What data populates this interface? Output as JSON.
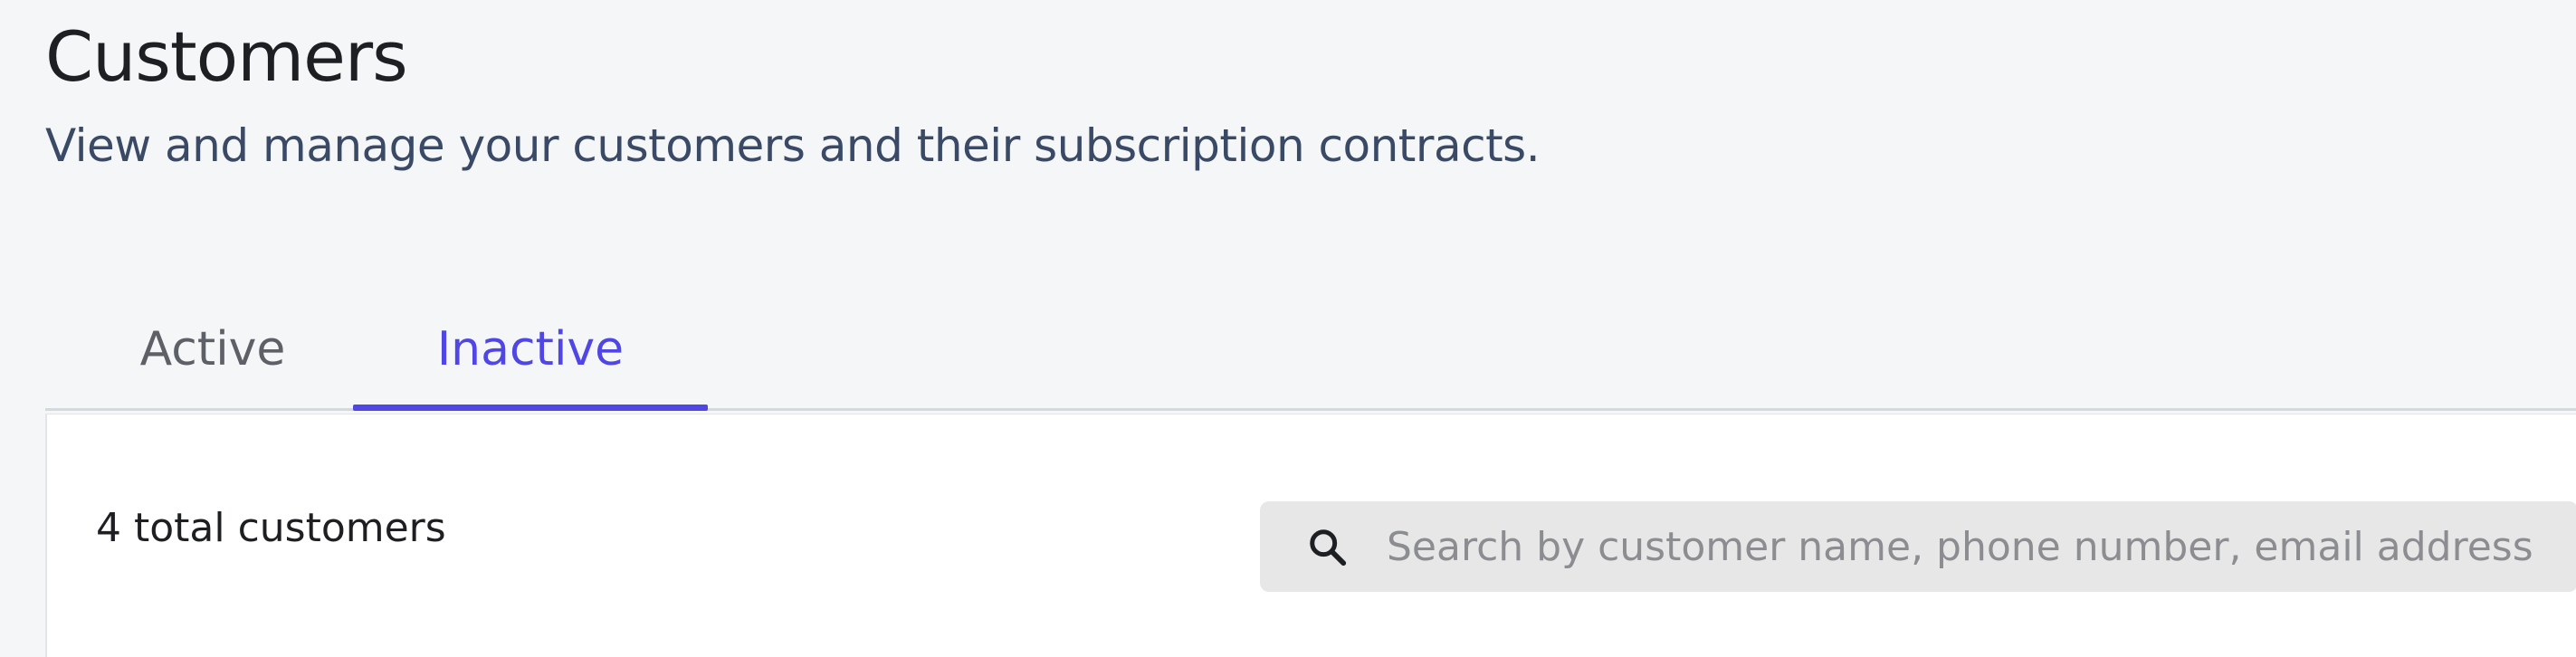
{
  "header": {
    "title": "Customers",
    "subtitle": "View and manage your customers and their subscription contracts."
  },
  "tabs": [
    {
      "label": "Active",
      "selected": false
    },
    {
      "label": "Inactive",
      "selected": true
    }
  ],
  "customers": {
    "total_label": "4 total customers",
    "search": {
      "placeholder": "Search by customer name, phone number, email address",
      "value": "",
      "icon": "search-icon"
    }
  },
  "colors": {
    "accent": "#4f46e5",
    "background": "#f5f6f8",
    "subtitle": "#3a4a66"
  }
}
